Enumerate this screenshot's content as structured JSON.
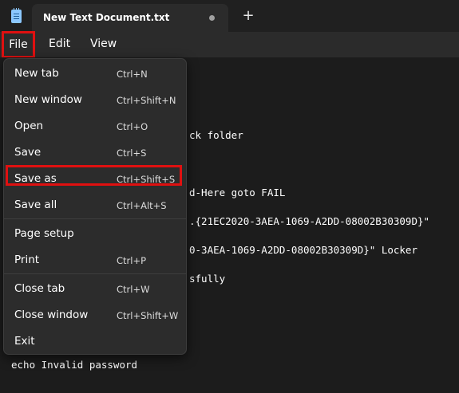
{
  "tab": {
    "title": "New Text Document.txt",
    "new_tab_glyph": "+"
  },
  "menubar": {
    "file": "File",
    "edit": "Edit",
    "view": "View"
  },
  "editor_lines": [
    "ck folder",
    "d-Here goto FAIL",
    ".{21EC2020-3AEA-1069-A2DD-08002B30309D}\"",
    "0-3AEA-1069-A2DD-08002B30309D}\" Locker",
    "sfully",
    "echo Invalid password"
  ],
  "file_menu": {
    "items": [
      {
        "label": "New tab",
        "shortcut": "Ctrl+N"
      },
      {
        "label": "New window",
        "shortcut": "Ctrl+Shift+N"
      },
      {
        "label": "Open",
        "shortcut": "Ctrl+O"
      },
      {
        "label": "Save",
        "shortcut": "Ctrl+S"
      },
      {
        "label": "Save as",
        "shortcut": "Ctrl+Shift+S"
      },
      {
        "label": "Save all",
        "shortcut": "Ctrl+Alt+S"
      },
      {
        "label": "Page setup",
        "shortcut": ""
      },
      {
        "label": "Print",
        "shortcut": "Ctrl+P"
      },
      {
        "label": "Close tab",
        "shortcut": "Ctrl+W"
      },
      {
        "label": "Close window",
        "shortcut": "Ctrl+Shift+W"
      },
      {
        "label": "Exit",
        "shortcut": ""
      }
    ]
  },
  "colors": {
    "highlight": "#e01010",
    "menu_bg": "#2c2c2c",
    "editor_bg": "#1c1c1c"
  }
}
